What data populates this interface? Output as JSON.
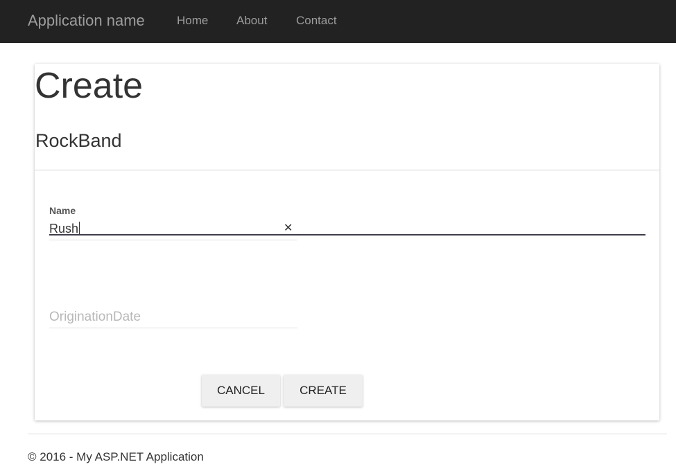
{
  "navbar": {
    "brand": "Application name",
    "links": [
      "Home",
      "About",
      "Contact"
    ],
    "background": "#222222",
    "text_color": "#9d9d9d"
  },
  "page": {
    "title": "Create",
    "entity": "RockBand"
  },
  "form": {
    "name": {
      "label": "Name",
      "value": "Rush",
      "clear_icon": "close-icon"
    },
    "origination_date": {
      "placeholder": "OriginationDate"
    },
    "buttons": {
      "cancel": "CANCEL",
      "create": "CREATE"
    }
  },
  "footer": {
    "text": "© 2016 - My ASP.NET Application"
  }
}
